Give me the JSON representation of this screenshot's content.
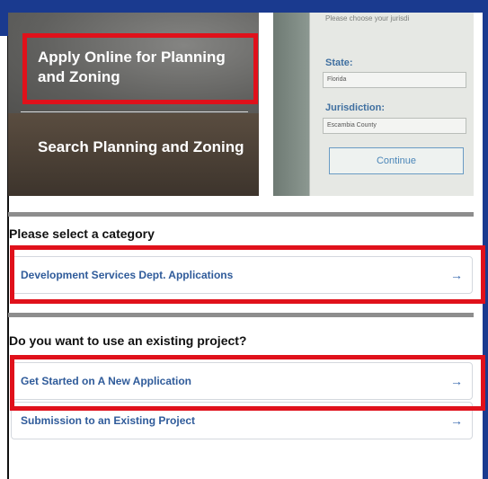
{
  "tiles": {
    "apply_online": "Apply Online for Planning and Zoning",
    "search": "Search Planning and Zoning"
  },
  "jurisdiction_preview": {
    "hint": "Please choose your jurisdi",
    "state_label": "State:",
    "state_value": "Florida",
    "jurisdiction_label": "Jurisdiction:",
    "jurisdiction_value": "Escambia County",
    "continue_label": "Continue"
  },
  "category_section": {
    "title": "Please select a category",
    "options": [
      {
        "label": "Development Services Dept. Applications",
        "icon": "arrow-right-icon"
      }
    ]
  },
  "project_section": {
    "title": "Do you want to use an existing project?",
    "options": [
      {
        "label": "Get Started on A New Application",
        "icon": "arrow-right-icon"
      },
      {
        "label": "Submission to an Existing Project",
        "icon": "arrow-right-icon"
      }
    ]
  },
  "colors": {
    "brand_blue": "#1a3a8f",
    "highlight_red": "#e0111b",
    "link_blue": "#2f5b9a"
  }
}
